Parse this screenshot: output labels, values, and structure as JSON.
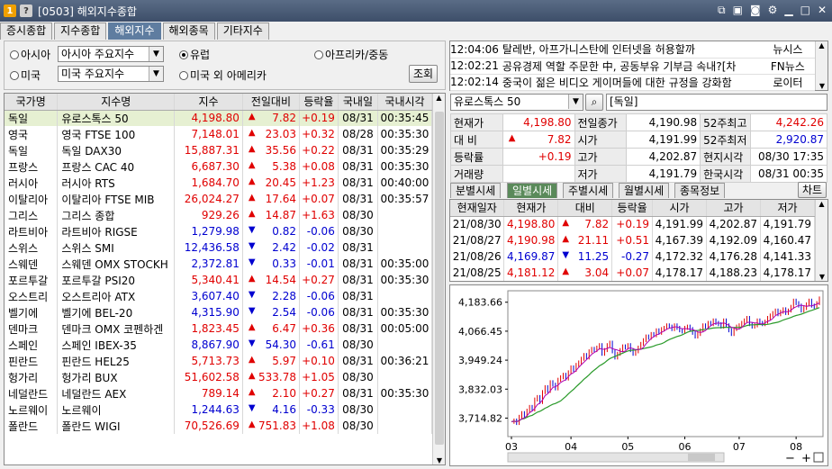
{
  "window": {
    "badge1": "1",
    "badge2": "?",
    "title": "[0503] 해외지수종합"
  },
  "tabs": [
    "증시종합",
    "지수종합",
    "해외지수",
    "해외종목",
    "기타지수"
  ],
  "filters": {
    "asia_radio": "아시아",
    "asia_combo": "아시아 주요지수",
    "europe_radio": "유럽",
    "africa_radio": "아프리카/중동",
    "america_radio": "미국",
    "america_combo": "미국 주요지수",
    "america_other_radio": "미국 외 아메리카",
    "query_button": "조회"
  },
  "index_table": {
    "headers": [
      "국가명",
      "지수명",
      "지수",
      "전일대비",
      "등락율",
      "국내일",
      "국내시각"
    ],
    "rows": [
      [
        "독일",
        "유로스톡스 50",
        "4,198.80",
        "up",
        "7.82",
        "+0.19",
        "08/31",
        "00:35:45"
      ],
      [
        "영국",
        "영국 FTSE 100",
        "7,148.01",
        "up",
        "23.03",
        "+0.32",
        "08/28",
        "00:35:30"
      ],
      [
        "독일",
        "독일 DAX30",
        "15,887.31",
        "up",
        "35.56",
        "+0.22",
        "08/31",
        "00:35:29"
      ],
      [
        "프랑스",
        "프랑스 CAC 40",
        "6,687.30",
        "up",
        "5.38",
        "+0.08",
        "08/31",
        "00:35:30"
      ],
      [
        "러시아",
        "러시아 RTS",
        "1,684.70",
        "up",
        "20.45",
        "+1.23",
        "08/31",
        "00:40:00"
      ],
      [
        "이탈리아",
        "이탈리아 FTSE MIB",
        "26,024.27",
        "up",
        "17.64",
        "+0.07",
        "08/31",
        "00:35:57"
      ],
      [
        "그리스",
        "그리스 종합",
        "929.26",
        "up",
        "14.87",
        "+1.63",
        "08/30",
        ""
      ],
      [
        "라트비아",
        "라트비아 RIGSE",
        "1,279.98",
        "dn",
        "0.82",
        "-0.06",
        "08/30",
        ""
      ],
      [
        "스위스",
        "스위스 SMI",
        "12,436.58",
        "dn",
        "2.42",
        "-0.02",
        "08/31",
        ""
      ],
      [
        "스웨덴",
        "스웨덴 OMX STOCKH",
        "2,372.81",
        "dn",
        "0.33",
        "-0.01",
        "08/31",
        "00:35:00"
      ],
      [
        "포르투갈",
        "포르투갈 PSI20",
        "5,340.41",
        "up",
        "14.54",
        "+0.27",
        "08/31",
        "00:35:30"
      ],
      [
        "오스트리",
        "오스트리아 ATX",
        "3,607.40",
        "dn",
        "2.28",
        "-0.06",
        "08/31",
        ""
      ],
      [
        "벨기에",
        "벨기에 BEL-20",
        "4,315.90",
        "dn",
        "2.54",
        "-0.06",
        "08/31",
        "00:35:30"
      ],
      [
        "덴마크",
        "덴마크 OMX 코펜하겐",
        "1,823.45",
        "up",
        "6.47",
        "+0.36",
        "08/31",
        "00:05:00"
      ],
      [
        "스페인",
        "스페인 IBEX-35",
        "8,867.90",
        "dn",
        "54.30",
        "-0.61",
        "08/30",
        ""
      ],
      [
        "핀란드",
        "핀란드 HEL25",
        "5,713.73",
        "up",
        "5.97",
        "+0.10",
        "08/31",
        "00:36:21"
      ],
      [
        "헝가리",
        "헝가리 BUX",
        "51,602.58",
        "up",
        "533.78",
        "+1.05",
        "08/30",
        ""
      ],
      [
        "네덜란드",
        "네덜란드 AEX",
        "789.14",
        "up",
        "2.10",
        "+0.27",
        "08/31",
        "00:35:30"
      ],
      [
        "노르웨이",
        "노르웨이",
        "1,244.63",
        "dn",
        "4.16",
        "-0.33",
        "08/30",
        ""
      ],
      [
        "폴란드",
        "폴란드 WIGI",
        "70,526.69",
        "up",
        "751.83",
        "+1.08",
        "08/30",
        ""
      ]
    ]
  },
  "news": [
    [
      "12:04:06",
      "탈레반, 아프가니스탄에 인터넷을 허용할까",
      "뉴시스"
    ],
    [
      "12:02:21",
      "공유경제 역할 주문한 中, 공동부유 기부금 속내?[차",
      "FN뉴스"
    ],
    [
      "12:02:14",
      "중국이 젊은 비디오 게이머들에 대한 규정을 강화함",
      "로이터"
    ]
  ],
  "selected": {
    "name": "유로스톡스 50",
    "market": "[독일]"
  },
  "quote": {
    "rows": [
      [
        "현재가",
        "4,198.80",
        "",
        "전일종가",
        "4,190.98",
        "52주최고",
        "4,242.26"
      ],
      [
        "대 비",
        "7.82",
        "up",
        "시가",
        "4,191.99",
        "52주최저",
        "2,920.87"
      ],
      [
        "등락률",
        "+0.19",
        "",
        "고가",
        "4,202.87",
        "현지시각",
        "08/30 17:35"
      ],
      [
        "거래량",
        "",
        "",
        "저가",
        "4,191.79",
        "한국시각",
        "08/31 00:35"
      ]
    ]
  },
  "subtabs": [
    "분별시세",
    "일별시세",
    "주별시세",
    "월별시세",
    "종목정보"
  ],
  "chart_button": "차트",
  "daily": {
    "headers": [
      "현재일자",
      "현재가",
      "대비",
      "등락율",
      "시가",
      "고가",
      "저가"
    ],
    "rows": [
      [
        "21/08/30",
        "4,198.80",
        "up",
        "7.82",
        "+0.19",
        "4,191.99",
        "4,202.87",
        "4,191.79"
      ],
      [
        "21/08/27",
        "4,190.98",
        "up",
        "21.11",
        "+0.51",
        "4,167.39",
        "4,192.09",
        "4,160.47"
      ],
      [
        "21/08/26",
        "4,169.87",
        "dn",
        "11.25",
        "-0.27",
        "4,172.32",
        "4,176.28",
        "4,141.33"
      ],
      [
        "21/08/25",
        "4,181.12",
        "up",
        "3.04",
        "+0.07",
        "4,178.17",
        "4,188.23",
        "4,178.17"
      ]
    ]
  },
  "chart_data": {
    "type": "line",
    "ylim": [
      3640,
      4230
    ],
    "yticks": [
      "4,183.66",
      "4,066.45",
      "3,949.24",
      "3,832.03",
      "3,714.82"
    ],
    "ytick_values": [
      4183.66,
      4066.45,
      3949.24,
      3832.03,
      3714.82
    ],
    "xticks": [
      "03",
      "04",
      "05",
      "06",
      "07",
      "08"
    ],
    "xtick_index": [
      0,
      23,
      45,
      67,
      88,
      110
    ],
    "series": [
      {
        "values": [
          3700,
          3705,
          3695,
          3720,
          3735,
          3725,
          3745,
          3760,
          3750,
          3790,
          3800,
          3780,
          3820,
          3840,
          3825,
          3860,
          3850,
          3835,
          3870,
          3880,
          3890,
          3875,
          3900,
          3920,
          3910,
          3930,
          3940,
          3955,
          3970,
          3960,
          3985,
          3995,
          3990,
          4000,
          4010,
          3975,
          3990,
          4010,
          4020,
          3985,
          3960,
          3975,
          3990,
          4005,
          4000,
          4010,
          3990,
          3975,
          3985,
          4000,
          4015,
          4030,
          4045,
          4040,
          4055,
          4050,
          4070,
          4060,
          4075,
          4080,
          4090,
          4085,
          4075,
          4090,
          4080,
          4070,
          4065,
          4080,
          4085,
          4075,
          4060,
          4045,
          4055,
          4070,
          4090,
          4085,
          4100,
          4095,
          4110,
          4100,
          4095,
          4085,
          4110,
          4090,
          4070,
          4055,
          4075,
          4085,
          4090,
          4100,
          4110,
          4120,
          4095,
          4085,
          4090,
          4110,
          4100,
          4095,
          4105,
          4120,
          4130,
          4140,
          4150,
          4135,
          4145,
          4155,
          4140,
          4150,
          4165,
          4190,
          4180,
          4170,
          4150,
          4160,
          4175,
          4190,
          4170,
          4165,
          4180,
          4199
        ]
      }
    ]
  },
  "chart_toolbar": {
    "minus": "−",
    "plus": "+"
  },
  "colors": {
    "up": "#e00000",
    "down": "#0000d0",
    "selected_row": "#e6f0d2",
    "tab_active": "#5f7da0"
  }
}
